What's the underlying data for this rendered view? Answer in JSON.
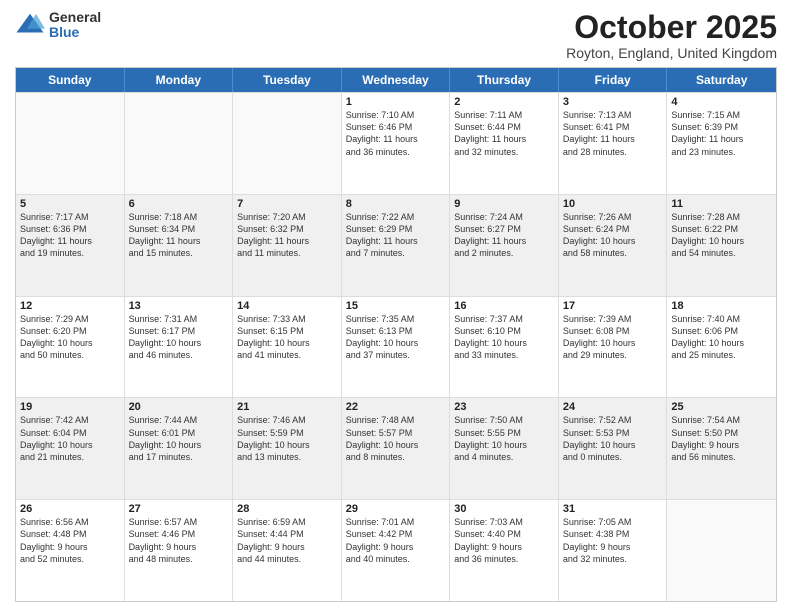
{
  "header": {
    "logo_general": "General",
    "logo_blue": "Blue",
    "month_title": "October 2025",
    "location": "Royton, England, United Kingdom"
  },
  "days_of_week": [
    "Sunday",
    "Monday",
    "Tuesday",
    "Wednesday",
    "Thursday",
    "Friday",
    "Saturday"
  ],
  "weeks": [
    [
      {
        "day": "",
        "info": ""
      },
      {
        "day": "",
        "info": ""
      },
      {
        "day": "",
        "info": ""
      },
      {
        "day": "1",
        "info": "Sunrise: 7:10 AM\nSunset: 6:46 PM\nDaylight: 11 hours\nand 36 minutes."
      },
      {
        "day": "2",
        "info": "Sunrise: 7:11 AM\nSunset: 6:44 PM\nDaylight: 11 hours\nand 32 minutes."
      },
      {
        "day": "3",
        "info": "Sunrise: 7:13 AM\nSunset: 6:41 PM\nDaylight: 11 hours\nand 28 minutes."
      },
      {
        "day": "4",
        "info": "Sunrise: 7:15 AM\nSunset: 6:39 PM\nDaylight: 11 hours\nand 23 minutes."
      }
    ],
    [
      {
        "day": "5",
        "info": "Sunrise: 7:17 AM\nSunset: 6:36 PM\nDaylight: 11 hours\nand 19 minutes."
      },
      {
        "day": "6",
        "info": "Sunrise: 7:18 AM\nSunset: 6:34 PM\nDaylight: 11 hours\nand 15 minutes."
      },
      {
        "day": "7",
        "info": "Sunrise: 7:20 AM\nSunset: 6:32 PM\nDaylight: 11 hours\nand 11 minutes."
      },
      {
        "day": "8",
        "info": "Sunrise: 7:22 AM\nSunset: 6:29 PM\nDaylight: 11 hours\nand 7 minutes."
      },
      {
        "day": "9",
        "info": "Sunrise: 7:24 AM\nSunset: 6:27 PM\nDaylight: 11 hours\nand 2 minutes."
      },
      {
        "day": "10",
        "info": "Sunrise: 7:26 AM\nSunset: 6:24 PM\nDaylight: 10 hours\nand 58 minutes."
      },
      {
        "day": "11",
        "info": "Sunrise: 7:28 AM\nSunset: 6:22 PM\nDaylight: 10 hours\nand 54 minutes."
      }
    ],
    [
      {
        "day": "12",
        "info": "Sunrise: 7:29 AM\nSunset: 6:20 PM\nDaylight: 10 hours\nand 50 minutes."
      },
      {
        "day": "13",
        "info": "Sunrise: 7:31 AM\nSunset: 6:17 PM\nDaylight: 10 hours\nand 46 minutes."
      },
      {
        "day": "14",
        "info": "Sunrise: 7:33 AM\nSunset: 6:15 PM\nDaylight: 10 hours\nand 41 minutes."
      },
      {
        "day": "15",
        "info": "Sunrise: 7:35 AM\nSunset: 6:13 PM\nDaylight: 10 hours\nand 37 minutes."
      },
      {
        "day": "16",
        "info": "Sunrise: 7:37 AM\nSunset: 6:10 PM\nDaylight: 10 hours\nand 33 minutes."
      },
      {
        "day": "17",
        "info": "Sunrise: 7:39 AM\nSunset: 6:08 PM\nDaylight: 10 hours\nand 29 minutes."
      },
      {
        "day": "18",
        "info": "Sunrise: 7:40 AM\nSunset: 6:06 PM\nDaylight: 10 hours\nand 25 minutes."
      }
    ],
    [
      {
        "day": "19",
        "info": "Sunrise: 7:42 AM\nSunset: 6:04 PM\nDaylight: 10 hours\nand 21 minutes."
      },
      {
        "day": "20",
        "info": "Sunrise: 7:44 AM\nSunset: 6:01 PM\nDaylight: 10 hours\nand 17 minutes."
      },
      {
        "day": "21",
        "info": "Sunrise: 7:46 AM\nSunset: 5:59 PM\nDaylight: 10 hours\nand 13 minutes."
      },
      {
        "day": "22",
        "info": "Sunrise: 7:48 AM\nSunset: 5:57 PM\nDaylight: 10 hours\nand 8 minutes."
      },
      {
        "day": "23",
        "info": "Sunrise: 7:50 AM\nSunset: 5:55 PM\nDaylight: 10 hours\nand 4 minutes."
      },
      {
        "day": "24",
        "info": "Sunrise: 7:52 AM\nSunset: 5:53 PM\nDaylight: 10 hours\nand 0 minutes."
      },
      {
        "day": "25",
        "info": "Sunrise: 7:54 AM\nSunset: 5:50 PM\nDaylight: 9 hours\nand 56 minutes."
      }
    ],
    [
      {
        "day": "26",
        "info": "Sunrise: 6:56 AM\nSunset: 4:48 PM\nDaylight: 9 hours\nand 52 minutes."
      },
      {
        "day": "27",
        "info": "Sunrise: 6:57 AM\nSunset: 4:46 PM\nDaylight: 9 hours\nand 48 minutes."
      },
      {
        "day": "28",
        "info": "Sunrise: 6:59 AM\nSunset: 4:44 PM\nDaylight: 9 hours\nand 44 minutes."
      },
      {
        "day": "29",
        "info": "Sunrise: 7:01 AM\nSunset: 4:42 PM\nDaylight: 9 hours\nand 40 minutes."
      },
      {
        "day": "30",
        "info": "Sunrise: 7:03 AM\nSunset: 4:40 PM\nDaylight: 9 hours\nand 36 minutes."
      },
      {
        "day": "31",
        "info": "Sunrise: 7:05 AM\nSunset: 4:38 PM\nDaylight: 9 hours\nand 32 minutes."
      },
      {
        "day": "",
        "info": ""
      }
    ]
  ]
}
